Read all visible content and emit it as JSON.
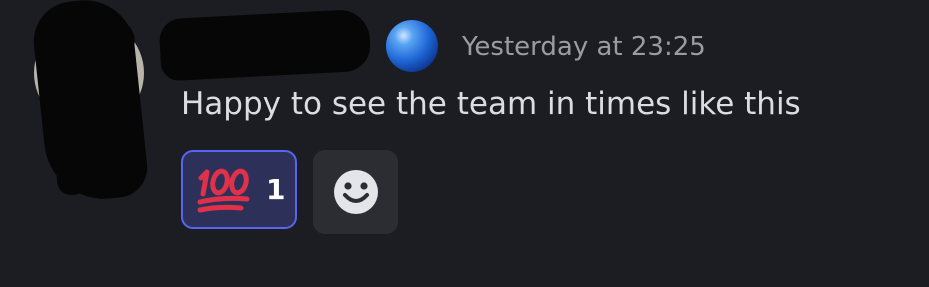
{
  "message": {
    "timestamp": "Yesterday at 23:25",
    "content": "Happy to see the team in times like this",
    "avatar_icon": "avatar-redacted",
    "username_redacted": true,
    "badge_icon": "blue-orb-icon"
  },
  "reactions": [
    {
      "emoji_icon": "hundred-points-icon",
      "count": "1",
      "selected": true
    }
  ],
  "add_reaction": {
    "icon": "smiley-add-reaction-icon"
  },
  "colors": {
    "background": "#1c1d22",
    "text": "#dcdde1",
    "muted": "#9b9ca3",
    "reaction_border": "#5865f2",
    "reaction_bg": "#2d3159",
    "hundred_red": "#e0314a"
  }
}
